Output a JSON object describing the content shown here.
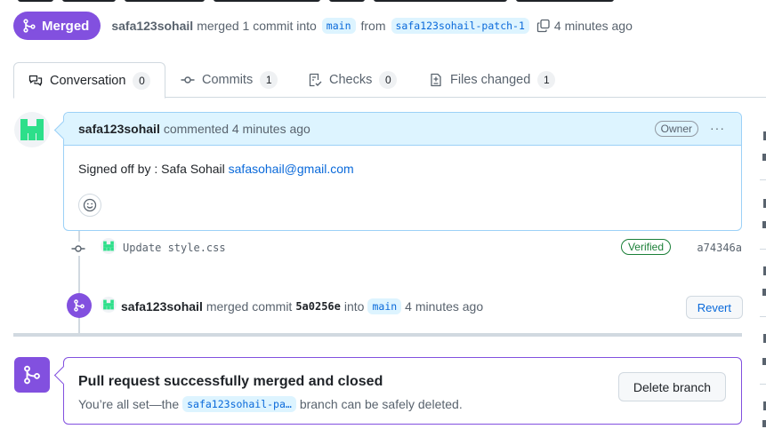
{
  "pr": {
    "state_label": "Merged",
    "author": "safa123sohail",
    "merge_summary": "merged 1 commit into",
    "base_branch": "main",
    "from_word": "from",
    "head_branch": "safa123sohail-patch-1",
    "time_ago": "4 minutes ago"
  },
  "tabs": [
    {
      "label": "Conversation",
      "count": "0",
      "icon": "comment-discussion-icon"
    },
    {
      "label": "Commits",
      "count": "1",
      "icon": "git-commit-icon"
    },
    {
      "label": "Checks",
      "count": "0",
      "icon": "checklist-icon"
    },
    {
      "label": "Files changed",
      "count": "1",
      "icon": "file-diff-icon"
    }
  ],
  "comment": {
    "author": "safa123sohail",
    "action": "commented 4 minutes ago",
    "badge": "Owner",
    "body_text": "Signed off by : Safa Sohail",
    "body_email": "safasohail@gmail.com",
    "more_label": "···"
  },
  "commit": {
    "message": "Update style.css",
    "verified_label": "Verified",
    "sha": "a74346a"
  },
  "merge_event": {
    "author": "safa123sohail",
    "action": "merged commit",
    "sha": "5a0256e",
    "into_word": "into",
    "branch": "main",
    "time_ago": "4 minutes ago",
    "revert_label": "Revert"
  },
  "merge_box": {
    "title": "Pull request successfully merged and closed",
    "sub_prefix": "You’re all set—the",
    "branch": "safa123sohail-pa…",
    "sub_suffix": "branch can be safely deleted.",
    "delete_label": "Delete branch"
  },
  "colors": {
    "merged_purple": "#8250df",
    "link_blue": "#0969da",
    "verified_green": "#1a7f37",
    "avatar_green": "#2ddf8a"
  }
}
